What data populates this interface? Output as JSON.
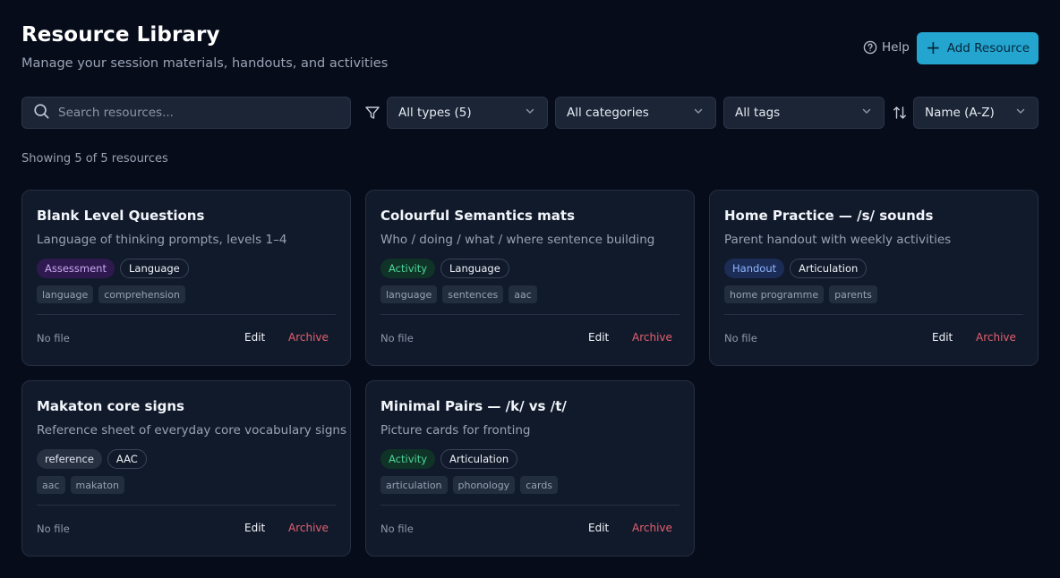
{
  "header": {
    "title": "Resource Library",
    "subtitle": "Manage your session materials, handouts, and activities",
    "help_label": "Help",
    "add_label": "Add Resource"
  },
  "filters": {
    "search_placeholder": "Search resources...",
    "type": "All types (5)",
    "category": "All categories",
    "tags": "All tags",
    "sort": "Name (A-Z)"
  },
  "count_text": "Showing 5 of 5 resources",
  "colors": {
    "accent": "#23a5d0",
    "archive": "#e5606d",
    "background": "#070c1a",
    "card": "#111a2b"
  },
  "resources": [
    {
      "title": "Blank Level Questions",
      "description": "Language of thinking prompts, levels 1–4",
      "type": "Assessment",
      "category": "Language",
      "tags": [
        "language",
        "comprehension"
      ],
      "file": "No file",
      "edit": "Edit",
      "archive": "Archive"
    },
    {
      "title": "Colourful Semantics mats",
      "description": "Who / doing / what / where sentence building",
      "type": "Activity",
      "category": "Language",
      "tags": [
        "language",
        "sentences",
        "aac"
      ],
      "file": "No file",
      "edit": "Edit",
      "archive": "Archive"
    },
    {
      "title": "Home Practice — /s/ sounds",
      "description": "Parent handout with weekly activities",
      "type": "Handout",
      "category": "Articulation",
      "tags": [
        "home programme",
        "parents"
      ],
      "file": "No file",
      "edit": "Edit",
      "archive": "Archive"
    },
    {
      "title": "Makaton core signs",
      "description": "Reference sheet of everyday core vocabulary signs",
      "type": "reference",
      "category": "AAC",
      "tags": [
        "aac",
        "makaton"
      ],
      "file": "No file",
      "edit": "Edit",
      "archive": "Archive"
    },
    {
      "title": "Minimal Pairs — /k/ vs /t/",
      "description": "Picture cards for fronting",
      "type": "Activity",
      "category": "Articulation",
      "tags": [
        "articulation",
        "phonology",
        "cards"
      ],
      "file": "No file",
      "edit": "Edit",
      "archive": "Archive"
    }
  ]
}
